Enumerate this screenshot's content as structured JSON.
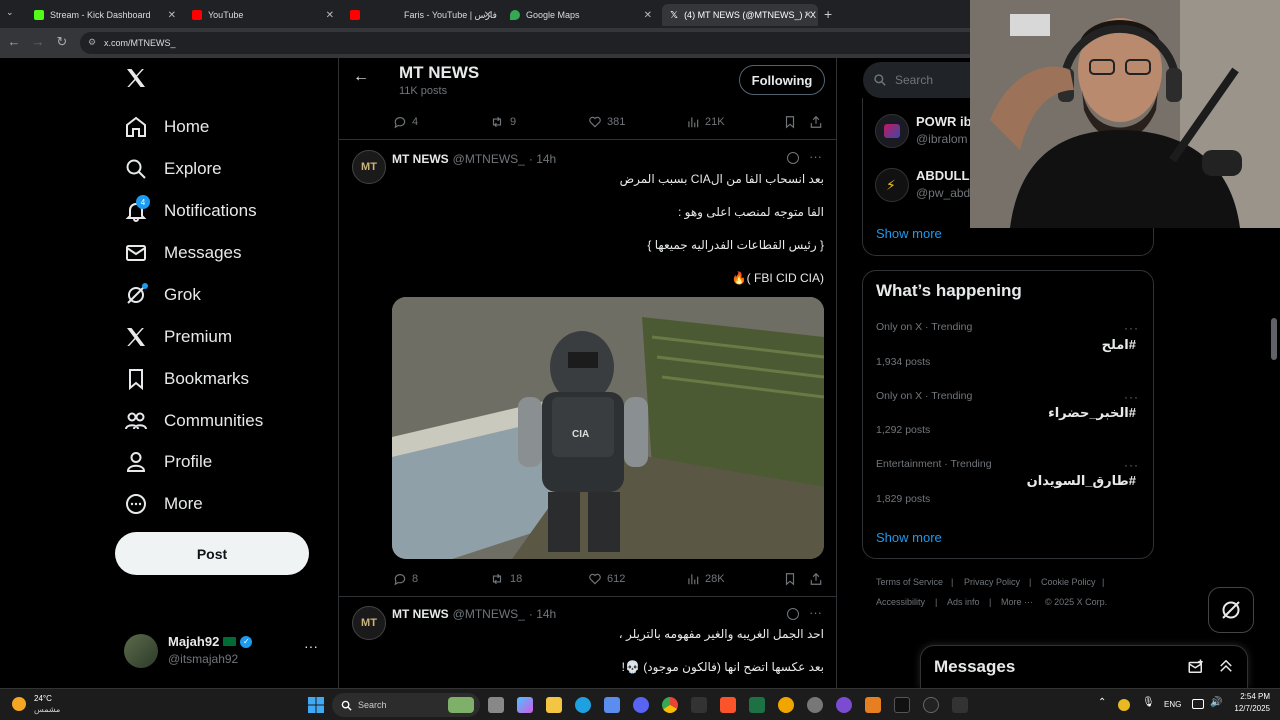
{
  "browser": {
    "tabs": [
      {
        "title": "Stream - Kick Dashboard",
        "color": "#53fc18"
      },
      {
        "title": "YouTube",
        "color": "#ff0000"
      },
      {
        "title": "Faris - YouTube | فارس",
        "color": "#ff0000"
      },
      {
        "title": "Google Maps",
        "color": "#34a853"
      },
      {
        "title": "(4) MT NEWS (@MTNEWS_) / X",
        "color": "#ffffff"
      }
    ],
    "url": "x.com/MTNEWS_"
  },
  "nav": {
    "items": [
      {
        "label": "Home",
        "icon": "home-icon"
      },
      {
        "label": "Explore",
        "icon": "search-icon"
      },
      {
        "label": "Notifications",
        "icon": "bell-icon",
        "badge": "4"
      },
      {
        "label": "Messages",
        "icon": "mail-icon"
      },
      {
        "label": "Grok",
        "icon": "grok-icon"
      },
      {
        "label": "Premium",
        "icon": "x-logo-icon"
      },
      {
        "label": "Bookmarks",
        "icon": "bookmark-icon"
      },
      {
        "label": "Communities",
        "icon": "people-icon"
      },
      {
        "label": "Profile",
        "icon": "person-icon"
      },
      {
        "label": "More",
        "icon": "more-circle-icon"
      }
    ],
    "post_label": "Post",
    "account": {
      "name": "Majah92",
      "handle": "@itsmajah92"
    }
  },
  "header": {
    "title": "MT NEWS",
    "post_count": "11K posts",
    "follow_label": "Following"
  },
  "feed": {
    "prev_actions": {
      "replies": "4",
      "reposts": "9",
      "likes": "381",
      "views": "21K"
    },
    "tweets": [
      {
        "name": "MT NEWS",
        "handle": "@MTNEWS_",
        "time": "· 14h",
        "avatar_text": "MT",
        "lines": [
          "بعد انسحاب الفا من الCIA بسبب المرض",
          "الفا متوجه لمنصب اعلى وهو :",
          "{ رئيس القطاعات الفدراليه جميعها }",
          "🔥( FBI CID CIA)"
        ],
        "media_text": "CIA",
        "actions": {
          "replies": "8",
          "reposts": "18",
          "likes": "612",
          "views": "28K"
        }
      },
      {
        "name": "MT NEWS",
        "handle": "@MTNEWS_",
        "time": "· 14h",
        "avatar_text": "MT",
        "lines": [
          "احد الجمل الغريبه والغير مفهومه بالتريلر ،",
          "بعد عكسها اتضح انها (فالكون موجود) 💀!"
        ]
      }
    ]
  },
  "sidebar": {
    "search_placeholder": "Search",
    "who_to_follow": [
      {
        "name": "POWR ib",
        "handle": "@ibralom"
      },
      {
        "name": "ABDULLA",
        "handle": "@pw_abd"
      }
    ],
    "show_more": "Show more",
    "happening_title": "What’s happening",
    "trends": [
      {
        "meta": "Only on X · Trending",
        "name": "#املح",
        "posts": "1,934 posts"
      },
      {
        "meta": "Only on X · Trending",
        "name": "#الخبر_حضراء",
        "posts": "1,292 posts"
      },
      {
        "meta": "Entertainment · Trending",
        "name": "#طارق_السويدان",
        "posts": "1,829 posts"
      }
    ],
    "show_more_2": "Show more",
    "footer": [
      "Terms of Service",
      "Privacy Policy",
      "Cookie Policy",
      "Accessibility",
      "Ads info",
      "More ···",
      "© 2025 X Corp."
    ],
    "messages_label": "Messages"
  },
  "taskbar": {
    "weather_temp": "24°C",
    "weather_desc": "مشمس",
    "search_label": "Search",
    "lang": "ENG",
    "time": "2:54 PM",
    "date": "12/7/2025"
  }
}
